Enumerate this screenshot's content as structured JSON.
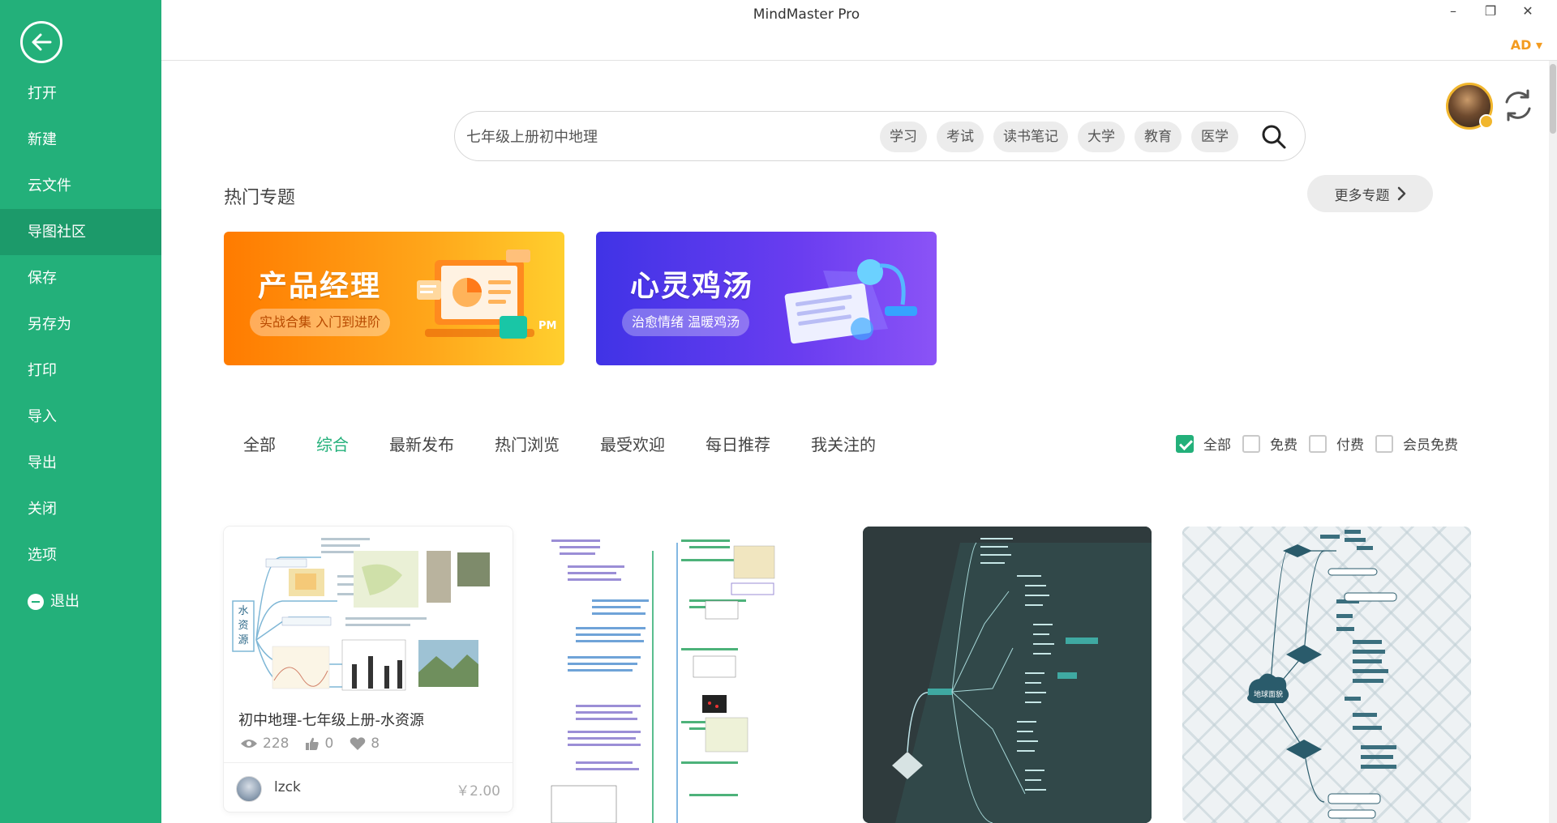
{
  "window": {
    "title": "MindMaster Pro",
    "minimize": "–",
    "restore": "❐",
    "close": "✕",
    "user_tag": "AD ▾"
  },
  "sidebar": {
    "items": [
      {
        "label": "打开"
      },
      {
        "label": "新建"
      },
      {
        "label": "云文件"
      },
      {
        "label": "导图社区",
        "active": true
      },
      {
        "label": "保存"
      },
      {
        "label": "另存为"
      },
      {
        "label": "打印"
      },
      {
        "label": "导入"
      },
      {
        "label": "导出"
      },
      {
        "label": "关闭"
      },
      {
        "label": "选项"
      },
      {
        "label": "退出"
      }
    ]
  },
  "search": {
    "placeholder": "七年级上册初中地理",
    "chips": [
      "学习",
      "考试",
      "读书笔记",
      "大学",
      "教育",
      "医学"
    ]
  },
  "topics": {
    "title": "热门专题",
    "more": "更多专题",
    "banners": [
      {
        "title": "产品经理",
        "subtitle": "实战合集 入门到进阶",
        "tag": "PM"
      },
      {
        "title": "心灵鸡汤",
        "subtitle": "治愈情绪 温暖鸡汤"
      }
    ]
  },
  "tabs": [
    "全部",
    "综合",
    "最新发布",
    "热门浏览",
    "最受欢迎",
    "每日推荐",
    "我关注的"
  ],
  "active_tab": "综合",
  "filters": [
    {
      "label": "全部",
      "checked": true
    },
    {
      "label": "免费",
      "checked": false
    },
    {
      "label": "付费",
      "checked": false
    },
    {
      "label": "会员免费",
      "checked": false
    }
  ],
  "cards": [
    {
      "title": "初中地理-七年级上册-水资源",
      "views": "228",
      "likes": "0",
      "favorites": "8",
      "author": "lzck",
      "price": "￥2.00",
      "thumb_text": [
        "水",
        "资",
        "源"
      ]
    },
    {},
    {},
    {
      "thumb_text": [
        "地球面貌"
      ]
    }
  ],
  "colors": {
    "accent": "#23b07a",
    "sidebar_active": "#1c9a6a",
    "user_tag": "#f39b1f"
  }
}
